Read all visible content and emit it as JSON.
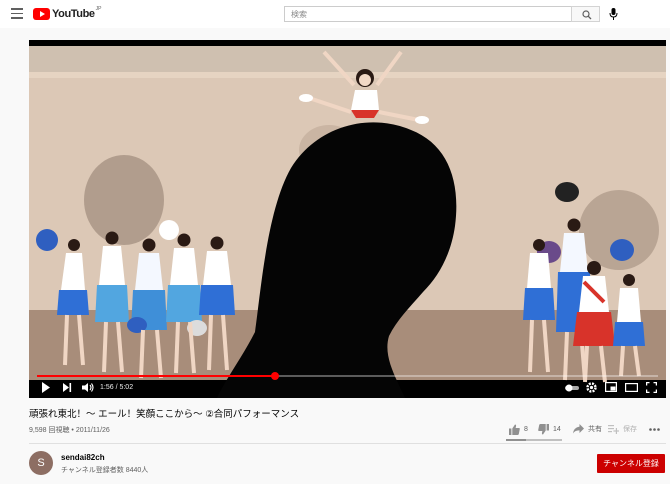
{
  "masthead": {
    "logo_text": "YouTube",
    "logo_region": "JP",
    "search_placeholder": "検索",
    "icons": [
      "menu-icon",
      "search-icon",
      "mic-icon"
    ]
  },
  "player": {
    "time_current": "1:56",
    "time_separator": " / ",
    "time_total": "5:02",
    "progress_fraction": 0.384,
    "icons": [
      "play-icon",
      "next-icon",
      "volume-icon",
      "autoplay-toggle",
      "settings-icon",
      "miniplayer-icon",
      "theater-icon",
      "fullscreen-icon"
    ]
  },
  "video": {
    "title": "頑張れ東北！～ エール！笑顔ここから～ ②合同パフォーマンス",
    "views": "9,598 回視聴",
    "separator": " • ",
    "date": "2011/11/26"
  },
  "actions": {
    "likes": "8",
    "dislikes": "14",
    "share_label": "共有",
    "save_label": "保存",
    "like_fraction": 0.36
  },
  "channel": {
    "avatar_letter": "S",
    "name": "sendai82ch",
    "subscribers": "チャンネル登録者数 8440人",
    "subscribe_label": "チャンネル登録"
  },
  "colors": {
    "brand_red": "#ff0000",
    "subscribe_red": "#cc0000",
    "page_bg": "#f9f9f9",
    "uniform_blue": "#2f6fd6",
    "uniform_red": "#d8332a"
  }
}
